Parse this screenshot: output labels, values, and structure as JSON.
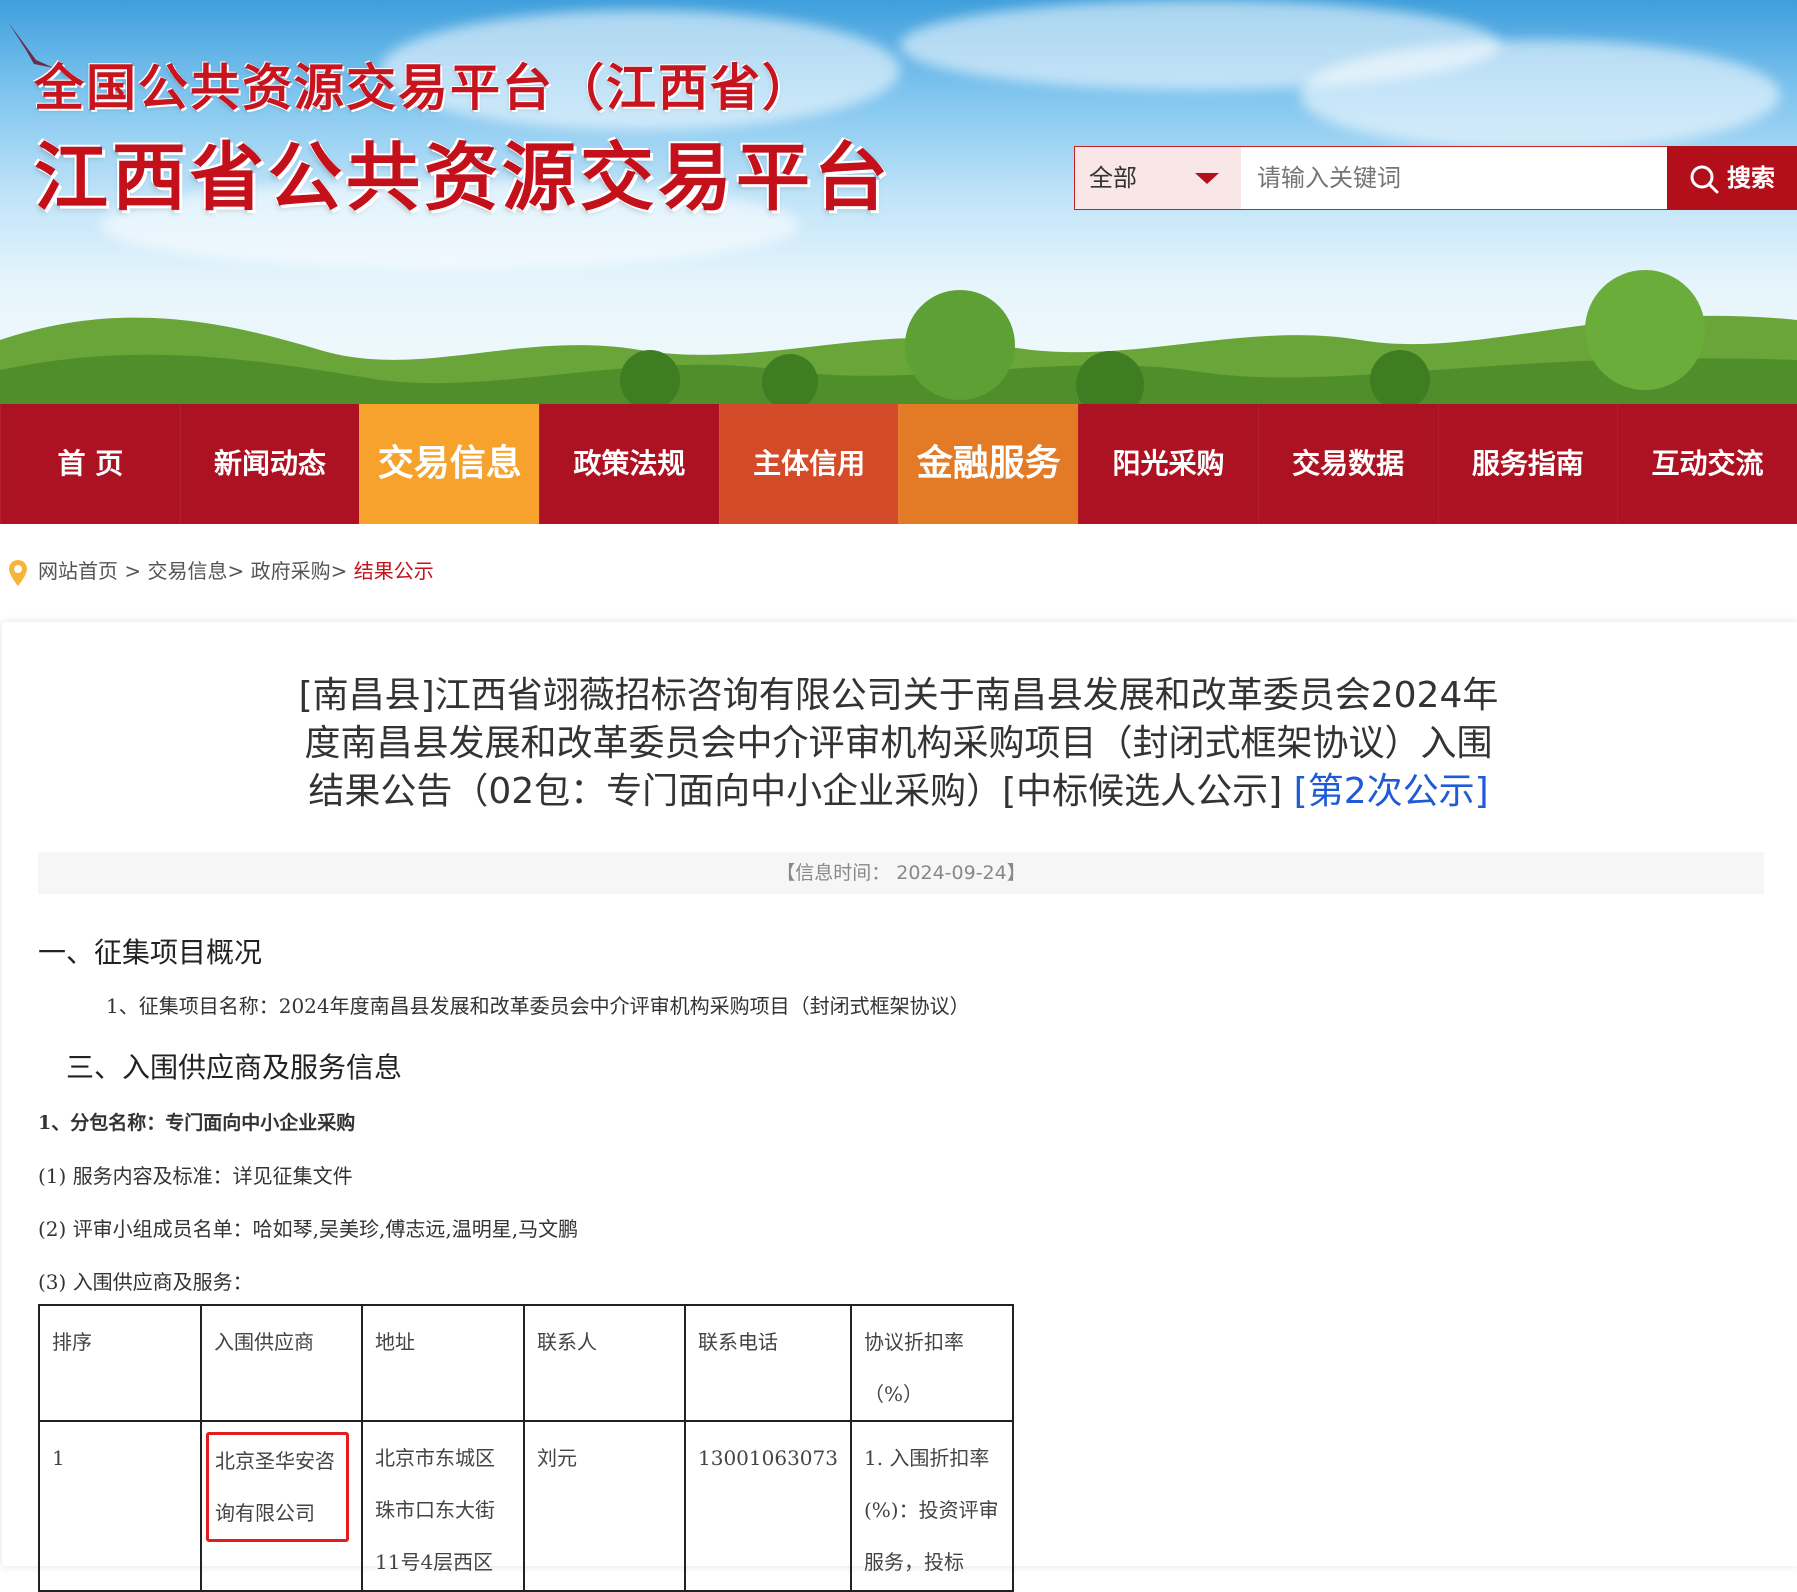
{
  "header": {
    "title_small": "全国公共资源交易平台（江西省）",
    "title_large": "江西省公共资源交易平台"
  },
  "search": {
    "scope": "全部",
    "placeholder": "请输入关键词",
    "button_label": "搜索"
  },
  "nav": {
    "items": [
      {
        "label": "首 页",
        "bg": "#ad1223"
      },
      {
        "label": "新闻动态",
        "bg": "#ad1223"
      },
      {
        "label": "交易信息",
        "bg": "#f6a22d"
      },
      {
        "label": "政策法规",
        "bg": "#ad1223"
      },
      {
        "label": "主体信用",
        "bg": "#d34b28"
      },
      {
        "label": "金融服务",
        "bg": "#e27a26"
      },
      {
        "label": "阳光采购",
        "bg": "#ad1223"
      },
      {
        "label": "交易数据",
        "bg": "#ad1223"
      },
      {
        "label": "服务指南",
        "bg": "#ad1223"
      },
      {
        "label": "互动交流",
        "bg": "#ad1223"
      }
    ]
  },
  "breadcrumb": {
    "home": "网站首页",
    "sep1": " > ",
    "level1": "交易信息",
    "sep2": "> ",
    "level2": "政府采购",
    "sep3": "> ",
    "current": "结果公示"
  },
  "article": {
    "title": "[南昌县]江西省翊薇招标咨询有限公司关于南昌县发展和改革委员会2024年度南昌县发展和改革委员会中介评审机构采购项目（封闭式框架协议）入围结果公告（02包：专门面向中小企业采购）[中标候选人公示]",
    "title_link": "[第2次公示]",
    "info_time": "【信息时间：  2024-09-24】"
  },
  "body": {
    "section1_heading": "一、征集项目概况",
    "section1_item1": "1、征集项目名称：2024年度南昌县发展和改革委员会中介评审机构采购项目（封闭式框架协议）",
    "section3_heading": "三、入围供应商及服务信息",
    "package_name": "1、分包名称：专门面向中小企业采购",
    "item1": "(1) 服务内容及标准：详见征集文件",
    "item2": "(2) 评审小组成员名单：哈如琴,吴美珍,傅志远,温明星,马文鹏",
    "item3": "(3) 入围供应商及服务："
  },
  "table": {
    "headers": [
      "排序",
      "入围供应商",
      "地址",
      "联系人",
      "联系电话",
      "协议折扣率（%）"
    ],
    "rows": [
      {
        "rank": "1",
        "supplier": "北京圣华安咨询有限公司",
        "address": "北京市东城区珠市口东大街11号4层西区",
        "contact": "刘元",
        "phone": "13001063073",
        "discount": "1. 入围折扣率(%)：投资评审服务，投标"
      }
    ]
  }
}
